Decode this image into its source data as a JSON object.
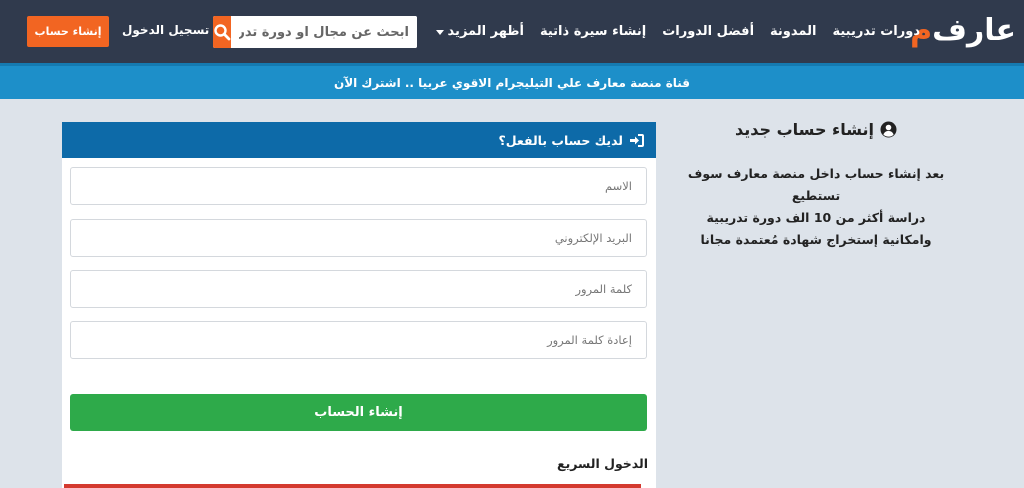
{
  "header": {
    "logo": {
      "part_dot": "م",
      "part_rest": "عارف"
    },
    "nav": [
      {
        "label": "دورات تدريبية"
      },
      {
        "label": "المدونة"
      },
      {
        "label": "أفضل الدورات"
      },
      {
        "label": "إنشاء سيرة ذاتية"
      },
      {
        "label": "أظهر المزيد"
      }
    ],
    "search_placeholder": "ابحث عن مجال او دورة تدريبية",
    "login_label": "تسجيل الدخول",
    "signup_label": "إنشاء حساب"
  },
  "banner": {
    "text": "قناة منصة معارف علي التيليجرام الاقوي عربيا .. اشترك الآن"
  },
  "info": {
    "title": "إنشاء حساب جديد",
    "lines": [
      "بعد إنشاء حساب داخل منصة معارف سوف تستطيع",
      "دراسة أكثر من 10 الف دورة تدريبية",
      "وامكانية إستخراج شهادة مُعتمدة مجانا"
    ]
  },
  "form": {
    "header": "لديك حساب بالفعل؟",
    "name_placeholder": "الاسم",
    "email_placeholder": "البريد الإلكتروني",
    "password_placeholder": "كلمة المرور",
    "password_confirm_placeholder": "إعادة كلمة المرور",
    "submit_label": "إنشاء الحساب",
    "quick_login": "الدخول السريع"
  },
  "colors": {
    "header_bg": "#303a4d",
    "accent_orange": "#f26522",
    "banner_blue": "#1d8fc9",
    "card_head_blue": "#0d6aa8",
    "submit_green": "#2eaa4a",
    "quick_red": "#d43a2f"
  }
}
